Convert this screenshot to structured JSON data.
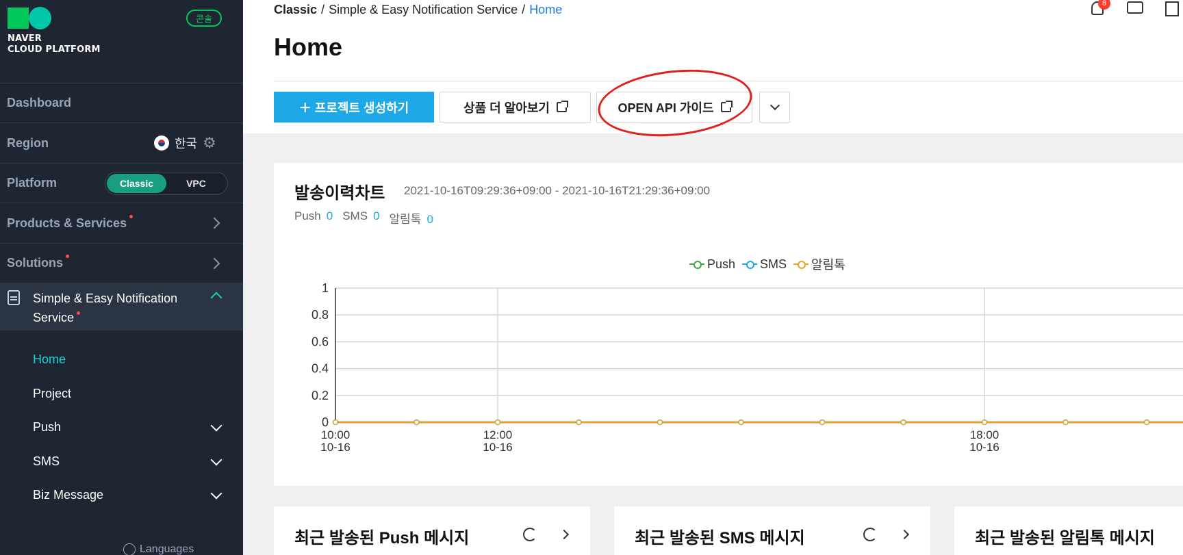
{
  "sidebar": {
    "logo_line1": "NAVER",
    "logo_line2": "CLOUD PLATFORM",
    "console_badge": "콘솔",
    "dashboard": "Dashboard",
    "region_label": "Region",
    "region_value": "한국",
    "platform_label": "Platform",
    "platform_options": [
      "Classic",
      "VPC"
    ],
    "platform_selected": "Classic",
    "products": "Products & Services",
    "solutions": "Solutions",
    "service_title_1": "Simple & Easy Notification",
    "service_title_2": "Service",
    "sub_items": [
      "Home",
      "Project",
      "Push",
      "SMS",
      "Biz Message"
    ],
    "languages": "Languages"
  },
  "header": {
    "breadcrumb": [
      "Classic",
      "Simple & Easy Notification Service",
      "Home"
    ],
    "notification_count": "8",
    "page_title": "Home"
  },
  "actions": {
    "create_project": "＋ 프로젝트 생성하기",
    "learn_more": "상품 더 알아보기",
    "api_guide": "OPEN API 가이드"
  },
  "chart_card": {
    "title": "발송이력차트",
    "range": "2021-10-16T09:29:36+09:00 - 2021-10-16T21:29:36+09:00",
    "counts": [
      {
        "label": "Push",
        "value": "0"
      },
      {
        "label": "SMS",
        "value": "0"
      },
      {
        "label": "알림톡",
        "value": "0"
      }
    ]
  },
  "chart_data": {
    "type": "line",
    "x": [
      "10:00",
      "11:00",
      "12:00",
      "13:00",
      "14:00",
      "15:00",
      "16:00",
      "17:00",
      "18:00",
      "19:00",
      "20:00"
    ],
    "x_tick_labels": [
      {
        "time": "10:00",
        "date": "10-16"
      },
      {
        "time": "12:00",
        "date": "10-16"
      },
      {
        "time": "18:00",
        "date": "10-16"
      }
    ],
    "series": [
      {
        "name": "Push",
        "color": "#3aa83a",
        "values": [
          0,
          0,
          0,
          0,
          0,
          0,
          0,
          0,
          0,
          0,
          0
        ]
      },
      {
        "name": "SMS",
        "color": "#1ea8e8",
        "values": [
          0,
          0,
          0,
          0,
          0,
          0,
          0,
          0,
          0,
          0,
          0
        ]
      },
      {
        "name": "알림톡",
        "color": "#f0a020",
        "values": [
          0,
          0,
          0,
          0,
          0,
          0,
          0,
          0,
          0,
          0,
          0
        ]
      }
    ],
    "y_ticks": [
      "1",
      "0.8",
      "0.6",
      "0.4",
      "0.2",
      "0"
    ],
    "ylim": [
      0,
      1
    ],
    "grid": true,
    "legend": "top-center"
  },
  "recent_cards": [
    {
      "title": "최근 발송된 Push 메시지"
    },
    {
      "title": "최근 발송된 SMS 메시지"
    },
    {
      "title": "최근 발송된 알림톡 메시지"
    }
  ]
}
